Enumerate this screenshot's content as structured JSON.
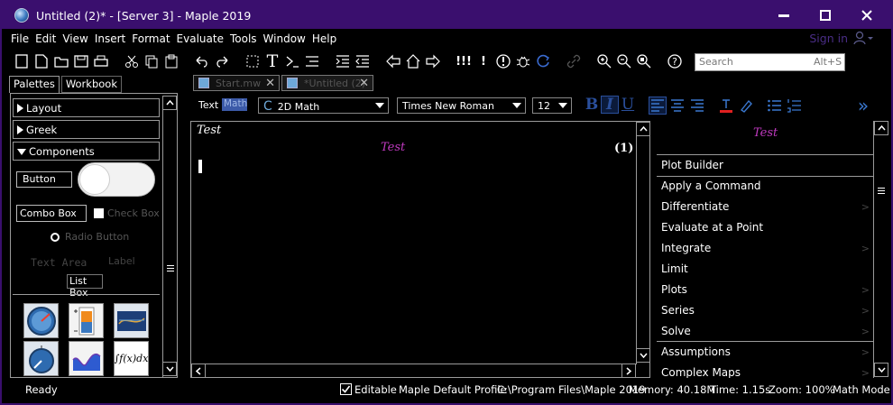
{
  "window": {
    "title": "Untitled (2)* - [Server 3] - Maple 2019",
    "controls": {
      "minimize": "▬",
      "maximize": "□",
      "close": "✕"
    }
  },
  "menubar": {
    "items": [
      "File",
      "Edit",
      "View",
      "Insert",
      "Format",
      "Evaluate",
      "Tools",
      "Window",
      "Help"
    ],
    "signin": "Sign in"
  },
  "toolbar": {
    "search_placeholder": "Search",
    "search_hint": "Alt+S",
    "glyphs": {
      "text_T": "T",
      "exec_all": "!!!",
      "exec": "!",
      "help": "?"
    }
  },
  "palettes": {
    "tabs": [
      "Palettes",
      "Workbook"
    ],
    "sections": [
      "Layout",
      "Greek",
      "Components"
    ],
    "components": {
      "button": "Button",
      "combo_box": "Combo Box",
      "check_box": "Check Box",
      "radio_button": "Radio Button",
      "text_area": "Text Area",
      "label": "Label",
      "list_box": "List Box"
    },
    "widgets": [
      "gauge-icon",
      "meter-icon",
      "plot-icon",
      "dial-icon",
      "mathcontainer-icon",
      "integral-icon"
    ],
    "integral_text": "∫f(x)dx"
  },
  "doc_tabs": [
    {
      "label": "Start.mw"
    },
    {
      "label": "*Untitled (2)"
    }
  ],
  "formatbar": {
    "mode_text": "Text",
    "mode_math": "Math",
    "style": "2D Math",
    "font": "Times New Roman",
    "size": "12",
    "bold": "B",
    "italic": "I",
    "underline": "U",
    "expand": "»"
  },
  "document": {
    "input": "Test",
    "output": "Test",
    "equation_label": "(1)"
  },
  "context_panel": {
    "preview": "Test",
    "items": [
      {
        "label": "Plot Builder",
        "submenu": false
      },
      {
        "label": "Apply a Command",
        "submenu": false
      },
      {
        "label": "Differentiate",
        "submenu": true
      },
      {
        "label": "Evaluate at a Point",
        "submenu": false
      },
      {
        "label": "Integrate",
        "submenu": true
      },
      {
        "label": "Limit",
        "submenu": false
      },
      {
        "label": "Plots",
        "submenu": true
      },
      {
        "label": "Series",
        "submenu": true
      },
      {
        "label": "Solve",
        "submenu": true
      },
      {
        "label": "Assumptions",
        "submenu": true
      },
      {
        "label": "Complex Maps",
        "submenu": true
      }
    ],
    "chevron": ">"
  },
  "statusbar": {
    "ready": "Ready",
    "editable": "Editable",
    "profile": "Maple Default Profile",
    "path": "C:\\Program Files\\Maple 2019",
    "memory": "Memory: 40.18M",
    "time": "Time: 1.15s",
    "zoom": "Zoom: 100%",
    "mode": "Math Mode"
  },
  "colors": {
    "titlebar": "#3a0f6e",
    "background": "#000000",
    "math_output": "#c03ac0",
    "accent_blue": "#2a4f9c"
  }
}
